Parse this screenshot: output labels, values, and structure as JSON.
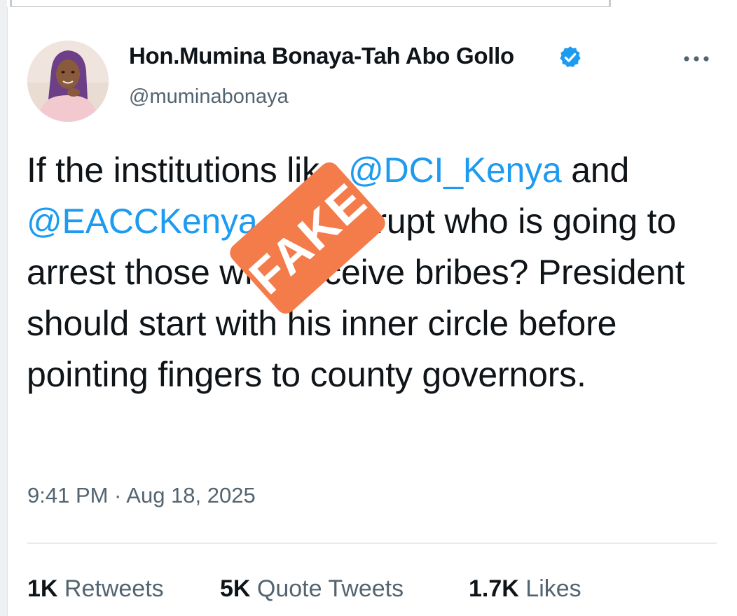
{
  "tweet": {
    "display_name": "Hon.Mumina Bonaya-Tah Abo Gollo",
    "handle": "@muminabonaya",
    "text_segments": [
      {
        "text": "If the institutions like ",
        "mention": false
      },
      {
        "text": "@DCI_Kenya",
        "mention": true
      },
      {
        "text": " and ",
        "mention": false
      },
      {
        "text": "@EACCKenya",
        "mention": true
      },
      {
        "text": " are corrupt who is going to arrest those who receive bribes? President should start with his inner circle before pointing fingers to county governors.",
        "mention": false
      }
    ],
    "timestamp": "9:41 PM · Aug 18, 2025",
    "stats": {
      "retweets_count": "1K",
      "retweets_label": "Retweets",
      "quotes_count": "5K",
      "quotes_label": "Quote Tweets",
      "likes_count": "1.7K",
      "likes_label": "Likes"
    }
  },
  "stamp": {
    "label": "FAKE",
    "color": "#f47c4a"
  },
  "icons": {
    "verified": "verified-badge-icon",
    "more": "more-options-icon"
  },
  "colors": {
    "mention": "#1d9bf0",
    "secondary_text": "#536471",
    "primary_text": "#0f1419",
    "verified": "#1d9bf0"
  }
}
